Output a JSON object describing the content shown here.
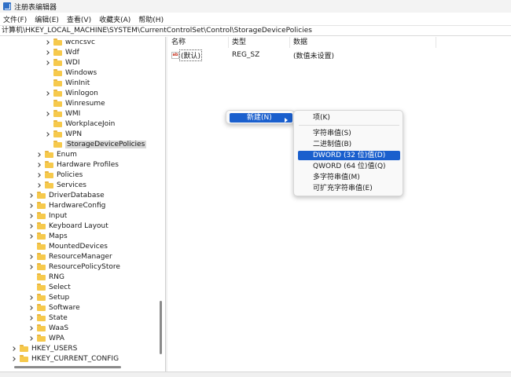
{
  "window": {
    "title": "注册表编辑器",
    "icon": "regedit-icon"
  },
  "menu": [
    "文件(F)",
    "编辑(E)",
    "查看(V)",
    "收藏夹(A)",
    "帮助(H)"
  ],
  "address": "计算机\\HKEY_LOCAL_MACHINE\\SYSTEM\\CurrentControlSet\\Control\\StorageDevicePolicies",
  "tree": [
    {
      "label": "wcncsvc",
      "expandable": true
    },
    {
      "label": "Wdf",
      "expandable": true
    },
    {
      "label": "WDI",
      "expandable": true
    },
    {
      "label": "Windows",
      "expandable": false
    },
    {
      "label": "WinInit",
      "expandable": false
    },
    {
      "label": "Winlogon",
      "expandable": true
    },
    {
      "label": "Winresume",
      "expandable": false
    },
    {
      "label": "WMI",
      "expandable": true
    },
    {
      "label": "WorkplaceJoin",
      "expandable": false
    },
    {
      "label": "WPN",
      "expandable": true
    },
    {
      "label": "StorageDevicePolicies",
      "expandable": false,
      "selected": true
    },
    {
      "label": "Enum",
      "expandable": true
    },
    {
      "label": "Hardware Profiles",
      "expandable": true
    },
    {
      "label": "Policies",
      "expandable": true
    },
    {
      "label": "Services",
      "expandable": true
    },
    {
      "label": "DriverDatabase",
      "expandable": true
    },
    {
      "label": "HardwareConfig",
      "expandable": true
    },
    {
      "label": "Input",
      "expandable": true
    },
    {
      "label": "Keyboard Layout",
      "expandable": true
    },
    {
      "label": "Maps",
      "expandable": true
    },
    {
      "label": "MountedDevices",
      "expandable": false
    },
    {
      "label": "ResourceManager",
      "expandable": true
    },
    {
      "label": "ResourcePolicyStore",
      "expandable": true
    },
    {
      "label": "RNG",
      "expandable": false
    },
    {
      "label": "Select",
      "expandable": false
    },
    {
      "label": "Setup",
      "expandable": true
    },
    {
      "label": "Software",
      "expandable": true
    },
    {
      "label": "State",
      "expandable": true
    },
    {
      "label": "WaaS",
      "expandable": true
    },
    {
      "label": "WPA",
      "expandable": true
    },
    {
      "label": "HKEY_USERS",
      "expandable": true
    },
    {
      "label": "HKEY_CURRENT_CONFIG",
      "expandable": true
    }
  ],
  "columns": {
    "name": "名称",
    "type": "类型",
    "data": "数据"
  },
  "values": [
    {
      "name": "(默认)",
      "type": "REG_SZ",
      "data": "(数值未设置)",
      "icon": "string-value-icon"
    }
  ],
  "context_menu": {
    "new_label": "新建(N)",
    "submenu": [
      "项(K)",
      "字符串值(S)",
      "二进制值(B)",
      "DWORD (32 位)值(D)",
      "QWORD (64 位)值(Q)",
      "多字符串值(M)",
      "可扩充字符串值(E)"
    ],
    "highlighted_index": 3
  },
  "colors": {
    "highlight": "#1a5fcd",
    "folder": "#f6c94c",
    "selection": "#d8d8d8"
  }
}
